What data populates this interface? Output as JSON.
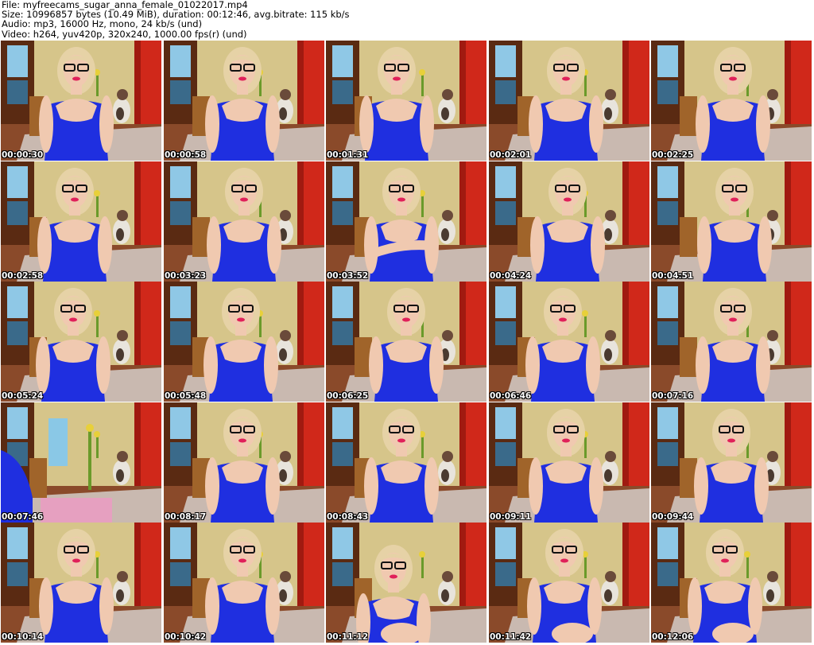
{
  "header": {
    "file_line": "File: myfreecams_sugar_anna_female_01022017.mp4",
    "size_line": "Size: 10996857 bytes (10.49 MiB), duration: 00:12:46, avg.bitrate: 115 kb/s",
    "audio_line": "Audio: mp3, 16000 Hz, mono, 24 kb/s (und)",
    "video_line": "Video: h264, yuv420p, 320x240, 1000.00 fps(r) (und)"
  },
  "thumbnails": [
    "00:00:30",
    "00:00:58",
    "00:01:31",
    "00:02:01",
    "00:02:25",
    "00:02:58",
    "00:03:23",
    "00:03:52",
    "00:04:24",
    "00:04:51",
    "00:05:24",
    "00:05:48",
    "00:06:25",
    "00:06:46",
    "00:07:16",
    "00:07:46",
    "00:08:17",
    "00:08:43",
    "00:09:11",
    "00:09:44",
    "00:10:14",
    "00:10:42",
    "00:11:12",
    "00:11:42",
    "00:12:06"
  ],
  "colors": {
    "dress": "#1f2fe0",
    "hair": "#e6d2a6",
    "skin": "#f0c9b0",
    "wall": "#d6c58a",
    "curtain": "#d0281a",
    "floor": "#8a4a2a",
    "rug": "#c9b9b0",
    "wood": "#5a2a12"
  }
}
